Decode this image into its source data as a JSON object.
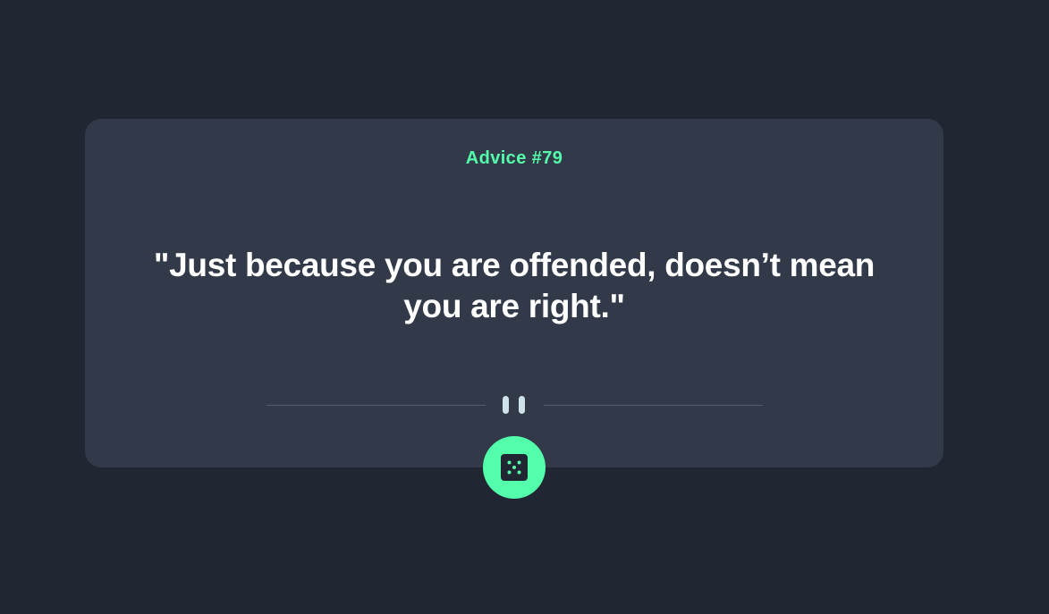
{
  "advice": {
    "id_label": "Advice #79",
    "quote": "\"Just because you are offended, doesn’t mean you are right.\""
  },
  "divider": {
    "icon": "pause-icon"
  },
  "action": {
    "icon": "dice-icon"
  },
  "colors": {
    "background": "#202632",
    "card": "#323a49",
    "accent": "#53ffaa",
    "text": "#ffffff",
    "divider_line": "#4f5d74",
    "pause_bars": "#cee3e9"
  }
}
